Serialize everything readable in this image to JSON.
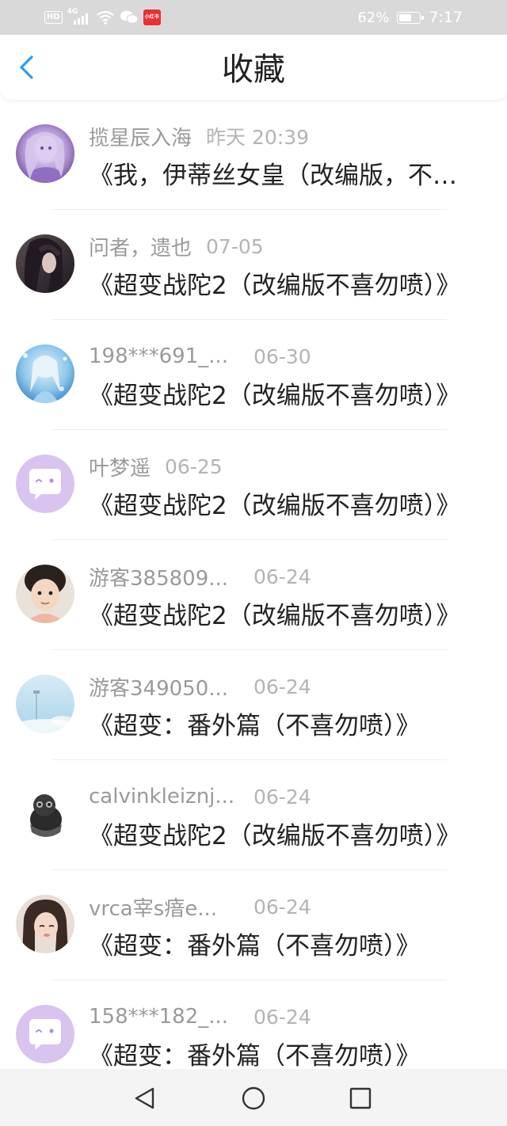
{
  "status_bar": {
    "hd": "HD",
    "network": "4G",
    "app_badge": "小红书",
    "battery": "62%",
    "time": "7:17"
  },
  "header": {
    "title": "收藏",
    "back_icon": "chevron-left-icon",
    "accent_color": "#2a9df4"
  },
  "favorites": [
    {
      "user": "揽星辰入海",
      "time": "昨天 20:39",
      "title": "《我，伊蒂丝女皇（改编版，不喜勿喷）》",
      "avatar": "anime-girl-purple"
    },
    {
      "user": "问者，遗也",
      "time": "07-05",
      "title": "《超变战陀2（改编版不喜勿喷）》",
      "avatar": "dark-portrait"
    },
    {
      "user": "198***691_...",
      "time": "06-30",
      "title": "《超变战陀2（改编版不喜勿喷）》",
      "avatar": "ice-princess"
    },
    {
      "user": "叶梦遥",
      "time": "06-25",
      "title": "《超变战陀2（改编版不喜勿喷）》",
      "avatar": "default-chat"
    },
    {
      "user": "游客385809...",
      "time": "06-24",
      "title": "《超变战陀2（改编版不喜勿喷）》",
      "avatar": "child-photo"
    },
    {
      "user": "游客349050...",
      "time": "06-24",
      "title": "《超变：番外篇（不喜勿喷）》",
      "avatar": "sky-field"
    },
    {
      "user": "calvinkleiznj...",
      "time": "06-24",
      "title": "《超变战陀2（改编版不喜勿喷）》",
      "avatar": "skull-ring"
    },
    {
      "user": "vrca宰s瘖e...",
      "time": "06-24",
      "title": "《超变：番外篇（不喜勿喷）》",
      "avatar": "girl-photo"
    },
    {
      "user": "158***182_...",
      "time": "06-24",
      "title": "《超变：番外篇（不喜勿喷）》",
      "avatar": "default-chat"
    }
  ],
  "nav_bar": {
    "back_icon": "triangle-back-icon",
    "home_icon": "circle-home-icon",
    "recent_icon": "square-recents-icon"
  }
}
